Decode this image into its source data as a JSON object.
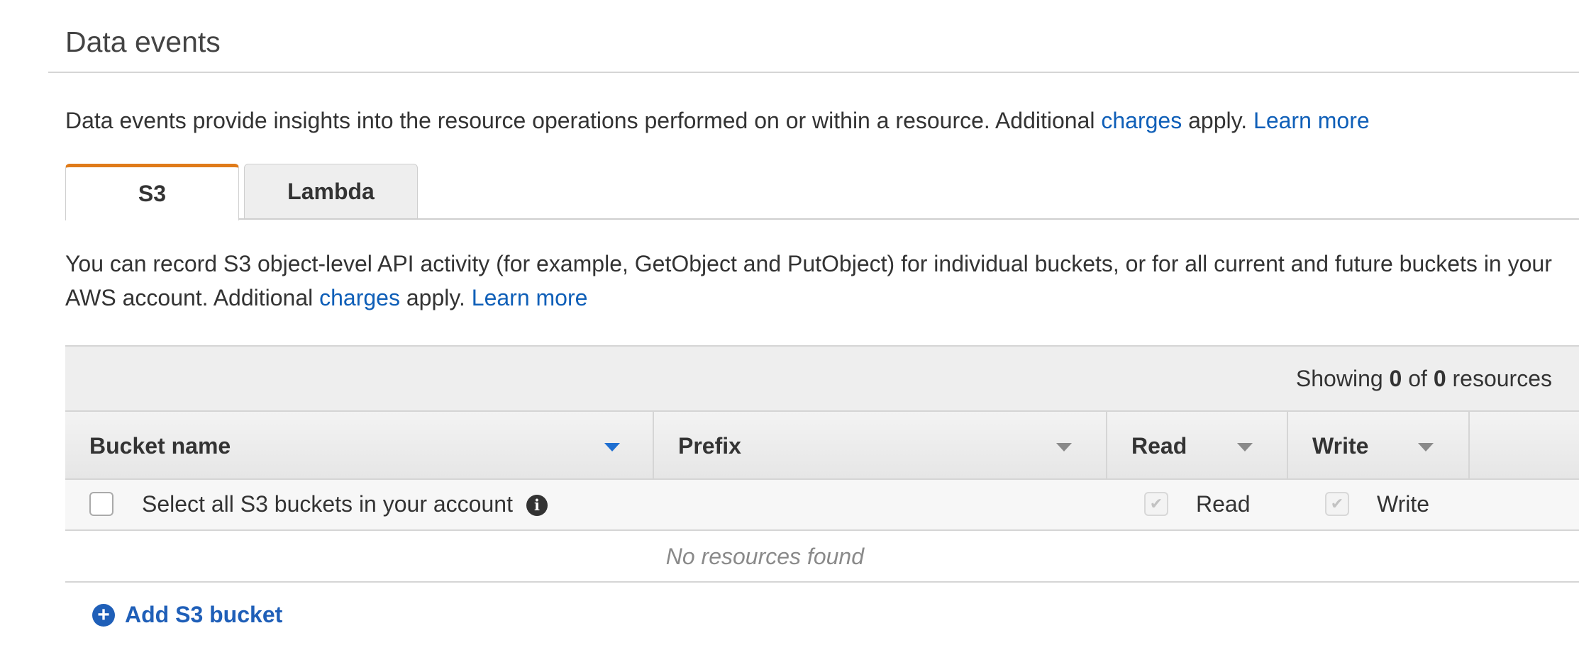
{
  "section": {
    "title": "Data events"
  },
  "intro": {
    "text_before": "Data events provide insights into the resource operations performed on or within a resource. Additional",
    "charges_link": "charges",
    "text_after": "apply.",
    "learn_more": "Learn more"
  },
  "tabs": [
    {
      "label": "S3",
      "active": true
    },
    {
      "label": "Lambda",
      "active": false
    }
  ],
  "s3_panel": {
    "description_before": "You can record S3 object-level API activity (for example, GetObject and PutObject) for individual buckets, or for all current and future buckets in your AWS account. Additional",
    "charges_link": "charges",
    "description_after": "apply.",
    "learn_more": "Learn more"
  },
  "table": {
    "showing_prefix": "Showing",
    "showing_count": "0",
    "showing_of": "of",
    "showing_total": "0",
    "showing_suffix": "resources",
    "columns": [
      {
        "label": "Bucket name",
        "sorted": true
      },
      {
        "label": "Prefix",
        "sorted": false
      },
      {
        "label": "Read",
        "sorted": false
      },
      {
        "label": "Write",
        "sorted": false
      }
    ],
    "select_all_row": {
      "label": "Select all S3 buckets in your account",
      "checked": false,
      "read_label": "Read",
      "read_checked": true,
      "write_label": "Write",
      "write_checked": true
    },
    "empty_message": "No resources found"
  },
  "add_button": {
    "label": "Add S3 bucket",
    "icon": "plus-circle-icon"
  },
  "colors": {
    "accent_tab": "#e07b19",
    "link": "#0f5fb8",
    "sort_active": "#1f6fd1"
  }
}
